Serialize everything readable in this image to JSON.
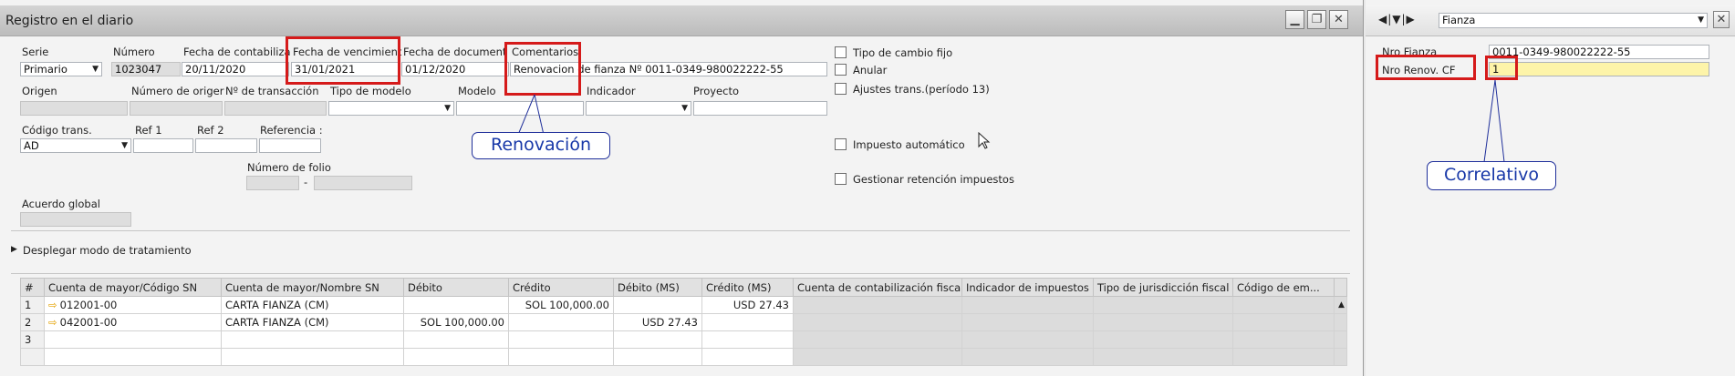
{
  "window": {
    "title": "Registro en el diario"
  },
  "header": {
    "serie": {
      "label": "Serie",
      "value": "Primario"
    },
    "numero": {
      "label": "Número",
      "value": "1023047"
    },
    "fecha_contab": {
      "label": "Fecha de contabiliza",
      "value": "20/11/2020"
    },
    "fecha_venc": {
      "label": "Fecha de vencimient",
      "value": "31/01/2021"
    },
    "fecha_doc": {
      "label": "Fecha de document",
      "value": "01/12/2020"
    },
    "comentarios": {
      "label": "Comentarios",
      "value": "Renovacion de fianza Nº 0011-0349-980022222-55"
    },
    "origen": {
      "label": "Origen"
    },
    "num_origen": {
      "label": "Número de origer"
    },
    "num_trans": {
      "label": "Nº de transacción"
    },
    "tipo_modelo": {
      "label": "Tipo de modelo"
    },
    "modelo": {
      "label": "Modelo"
    },
    "indicador": {
      "label": "Indicador"
    },
    "proyecto": {
      "label": "Proyecto"
    },
    "codigo_trans": {
      "label": "Código trans.",
      "value": "AD"
    },
    "ref1": {
      "label": "Ref 1"
    },
    "ref2": {
      "label": "Ref 2"
    },
    "referencia": {
      "label": "Referencia :"
    },
    "num_folio": {
      "label": "Número de folio",
      "dash": "-"
    },
    "acuerdo": {
      "label": "Acuerdo global"
    }
  },
  "checkboxes": {
    "tipo_cambio": "Tipo de cambio fijo",
    "anular": "Anular",
    "ajustes": "Ajustes trans.(período 13)",
    "impuesto_auto": "Impuesto automático",
    "gestionar": "Gestionar retención impuestos"
  },
  "expander": {
    "label": "Desplegar modo de tratamiento"
  },
  "grid": {
    "columns": [
      "#",
      "Cuenta de mayor/Código SN",
      "Cuenta de mayor/Nombre SN",
      "Débito",
      "Crédito",
      "Débito (MS)",
      "Crédito (MS)",
      "Cuenta de contabilización fiscal",
      "Indicador de impuestos",
      "Tipo de jurisdicción fiscal",
      "Código de em..."
    ],
    "rows": [
      {
        "n": "1",
        "codigo": "012001-00",
        "nombre": "CARTA FIANZA (CM)",
        "debito": "",
        "credito": "SOL 100,000.00",
        "debito_ms": "",
        "credito_ms": "USD 27.43"
      },
      {
        "n": "2",
        "codigo": "042001-00",
        "nombre": "CARTA FIANZA (CM)",
        "debito": "SOL 100,000.00",
        "credito": "",
        "debito_ms": "USD 27.43",
        "credito_ms": ""
      },
      {
        "n": "3",
        "codigo": "",
        "nombre": "",
        "debito": "",
        "credito": "",
        "debito_ms": "",
        "credito_ms": ""
      }
    ]
  },
  "annotations": {
    "renovacion": "Renovación",
    "correlativo": "Correlativo"
  },
  "side_panel": {
    "dropdown_value": "Fianza",
    "nro_fianza": {
      "label": "Nro Fianza",
      "value": "0011-0349-980022222-55"
    },
    "nro_renov": {
      "label": "Nro Renov. CF",
      "value": "1"
    }
  },
  "colors": {
    "highlight_red": "#d51a1a",
    "callout_blue": "#1838a8",
    "field_yellow": "#fdf4a9"
  }
}
